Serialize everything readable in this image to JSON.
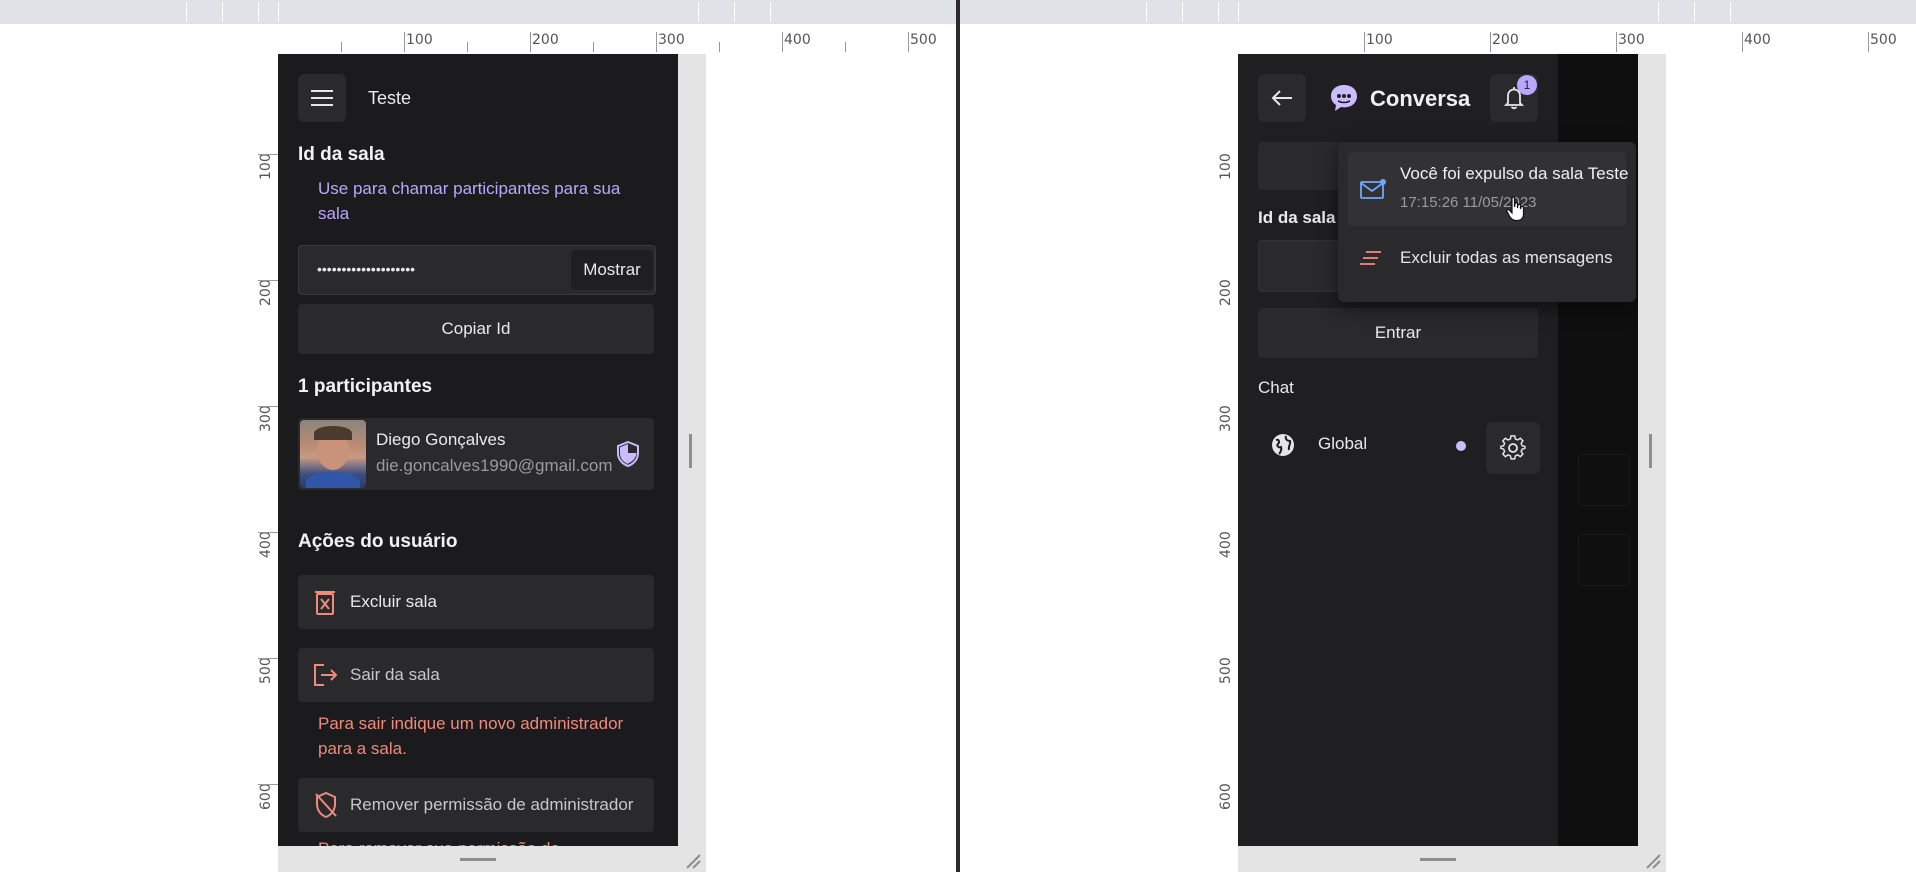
{
  "ruler": {
    "h_labels": [
      "100",
      "200",
      "300",
      "400",
      "500"
    ],
    "v_labels": [
      "100",
      "200",
      "300",
      "400",
      "500",
      "600"
    ]
  },
  "left": {
    "header": {
      "title": "Teste"
    },
    "room_id": {
      "heading": "Id da sala",
      "hint": "Use para chamar participantes para sua sala",
      "masked_value": "••••••••••••••••••••",
      "show_label": "Mostrar",
      "copy_label": "Copiar Id"
    },
    "participants": {
      "heading": "1 participantes",
      "items": [
        {
          "name": "Diego Gonçalves",
          "email": "die.goncalves1990@gmail.com",
          "icon": "admin-shield-icon"
        }
      ]
    },
    "actions": {
      "heading": "Ações do usuário",
      "delete_room": "Excluir sala",
      "leave_room": "Sair da sala",
      "leave_warning": "Para sair indique um novo administrador para a sala.",
      "remove_admin": "Remover permissão de administrador",
      "remove_warning": "Para remover sua permissão de"
    }
  },
  "right": {
    "header": {
      "title": "Conversa",
      "notification_count": "1"
    },
    "room_label": "Id da sala",
    "enter_label": "Entrar",
    "chat_heading": "Chat",
    "chat_item": {
      "label": "Global",
      "icon": "globe-icon"
    },
    "notifications": {
      "items": [
        {
          "title": "Você foi expulso da sala Teste",
          "time": "17:15:26 11/05/2023",
          "icon": "mail-icon"
        }
      ],
      "clear_label": "Excluir todas as mensagens"
    }
  },
  "colors": {
    "app_bg": "#1b1b1d",
    "surface": "#2a2a2d",
    "accent": "#b9a8ff",
    "danger": "#f08a7c"
  }
}
